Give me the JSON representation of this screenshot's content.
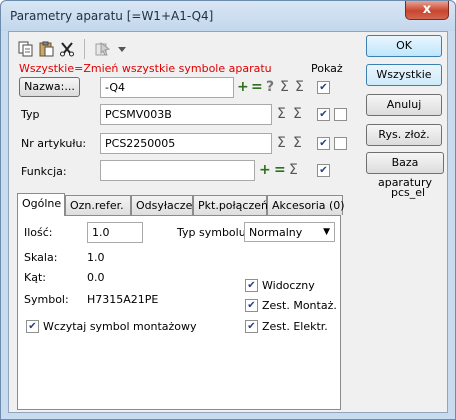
{
  "window": {
    "title": "Parametry aparatu [=W1+A1-Q4]",
    "close_label": "x"
  },
  "toolbar": {
    "icons": [
      "copy-icon",
      "paste-icon",
      "cut-icon",
      "symbol-icon"
    ]
  },
  "note": "Wszystkie=Zmień wszystkie symbole aparatu",
  "pokaz_label": "Pokaż",
  "fields": {
    "nazwa_button": "Nazwa:...",
    "nazwa_value": "-Q4",
    "typ_label": "Typ",
    "typ_value": "PCSMV003B",
    "nr_label": "Nr artykułu:",
    "nr_value": "PCS2250005",
    "funkcja_label": "Funkcja:",
    "funkcja_value": ""
  },
  "right_buttons": {
    "ok": "OK",
    "wszystkie": "Wszystkie",
    "anuluj": "Anuluj",
    "rys": "Rys. złoż.",
    "baza": "Baza aparatury",
    "pcs_label": "pcs_el"
  },
  "tabs": [
    "Ogólne",
    "Ozn.refer.",
    "Odsyłacze",
    "Pkt.połączeń",
    "Akcesoria (0)"
  ],
  "general": {
    "ilosc_label": "Ilość:",
    "ilosc_value": "1.0",
    "typ_symbolu_label": "Typ symbolu",
    "typ_symbolu_value": "Normalny",
    "skala_label": "Skala:",
    "skala_value": "1.0",
    "kat_label": "Kąt:",
    "kat_value": "0.0",
    "symbol_label": "Symbol:",
    "symbol_value": "H7315A21PE",
    "widoczny": "Widoczny",
    "zest_montaz": "Zest. Montaż.",
    "zest_elektr": "Zest. Elektr.",
    "wczytaj": "Wczytaj symbol montażowy"
  }
}
